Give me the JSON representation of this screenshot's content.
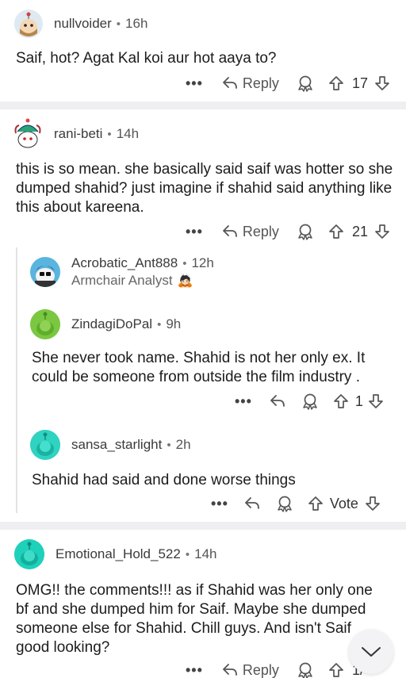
{
  "comments": [
    {
      "username": "nullvoider",
      "time": "16h",
      "body": "Saif, hot? Agat Kal koi aur hot aaya to?",
      "reply_label": "Reply",
      "votes": "17"
    },
    {
      "username": "rani-beti",
      "time": "14h",
      "body": "this is so mean. she basically said saif was hotter so she dumped shahid? just imagine if shahid said anything like this about kareena.",
      "reply_label": "Reply",
      "votes": "21"
    },
    {
      "username": "Acrobatic_Ant888",
      "time": "12h",
      "flair": "Armchair Analyst",
      "flair_emoji": "🙇🏻"
    },
    {
      "username": "ZindagiDoPal",
      "time": "9h",
      "body": "She never took name. Shahid is not her only ex. It could be someone from outside the film industry .",
      "votes": "1"
    },
    {
      "username": "sansa_starlight",
      "time": "2h",
      "body": "Shahid had said and done worse things",
      "votes": "Vote"
    },
    {
      "username": "Emotional_Hold_522",
      "time": "14h",
      "body": "OMG!! the comments!!! as if Shahid was her only one bf and she dumped him for Saif. Maybe she dumped someone else for Shahid. Chill guys. And isn't Saif good looking?",
      "reply_label": "Reply",
      "votes": "1/"
    }
  ],
  "more_label": "•••",
  "separator": "•",
  "colors": {
    "divider": "#efeff2",
    "green_avatar": "#7cc742",
    "teal_avatar": "#2fd3c0",
    "teal_avatar2": "#1fd0ba",
    "text": "#1c1c1c"
  },
  "icons": [
    "reply-icon",
    "award-icon",
    "upvote-icon",
    "downvote-icon",
    "scroll-down-chevron-icon"
  ]
}
